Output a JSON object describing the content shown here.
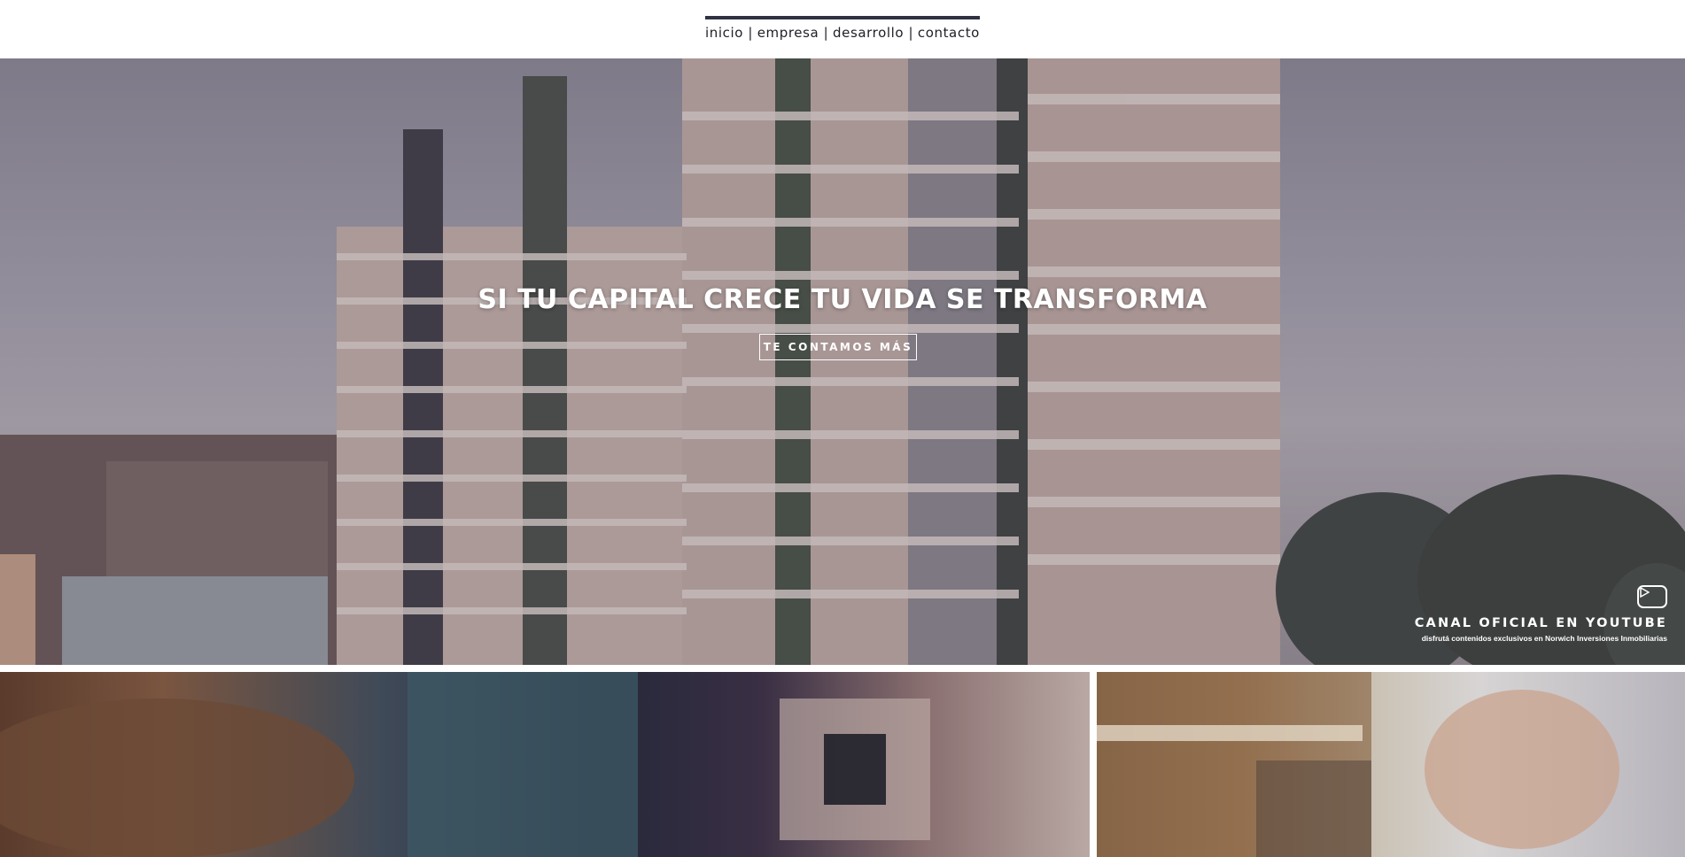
{
  "nav": {
    "items": [
      "inicio",
      "empresa",
      "desarrollo",
      "contacto"
    ],
    "separator": "|"
  },
  "hero": {
    "title": "SI TU CAPITAL CRECE TU VIDA SE TRANSFORMA",
    "button_label": "TE CONTAMOS MÁS"
  },
  "youtube": {
    "icon": "play-icon",
    "title": "CANAL OFICIAL EN YOUTUBE",
    "subtitle": "disfrutá contenidos exclusivos en Norwich Inversiones Inmobiliarias"
  },
  "colors": {
    "nav_bar": "#2f3242",
    "nav_text": "#1e1f26",
    "hero_text": "#ffffff"
  }
}
